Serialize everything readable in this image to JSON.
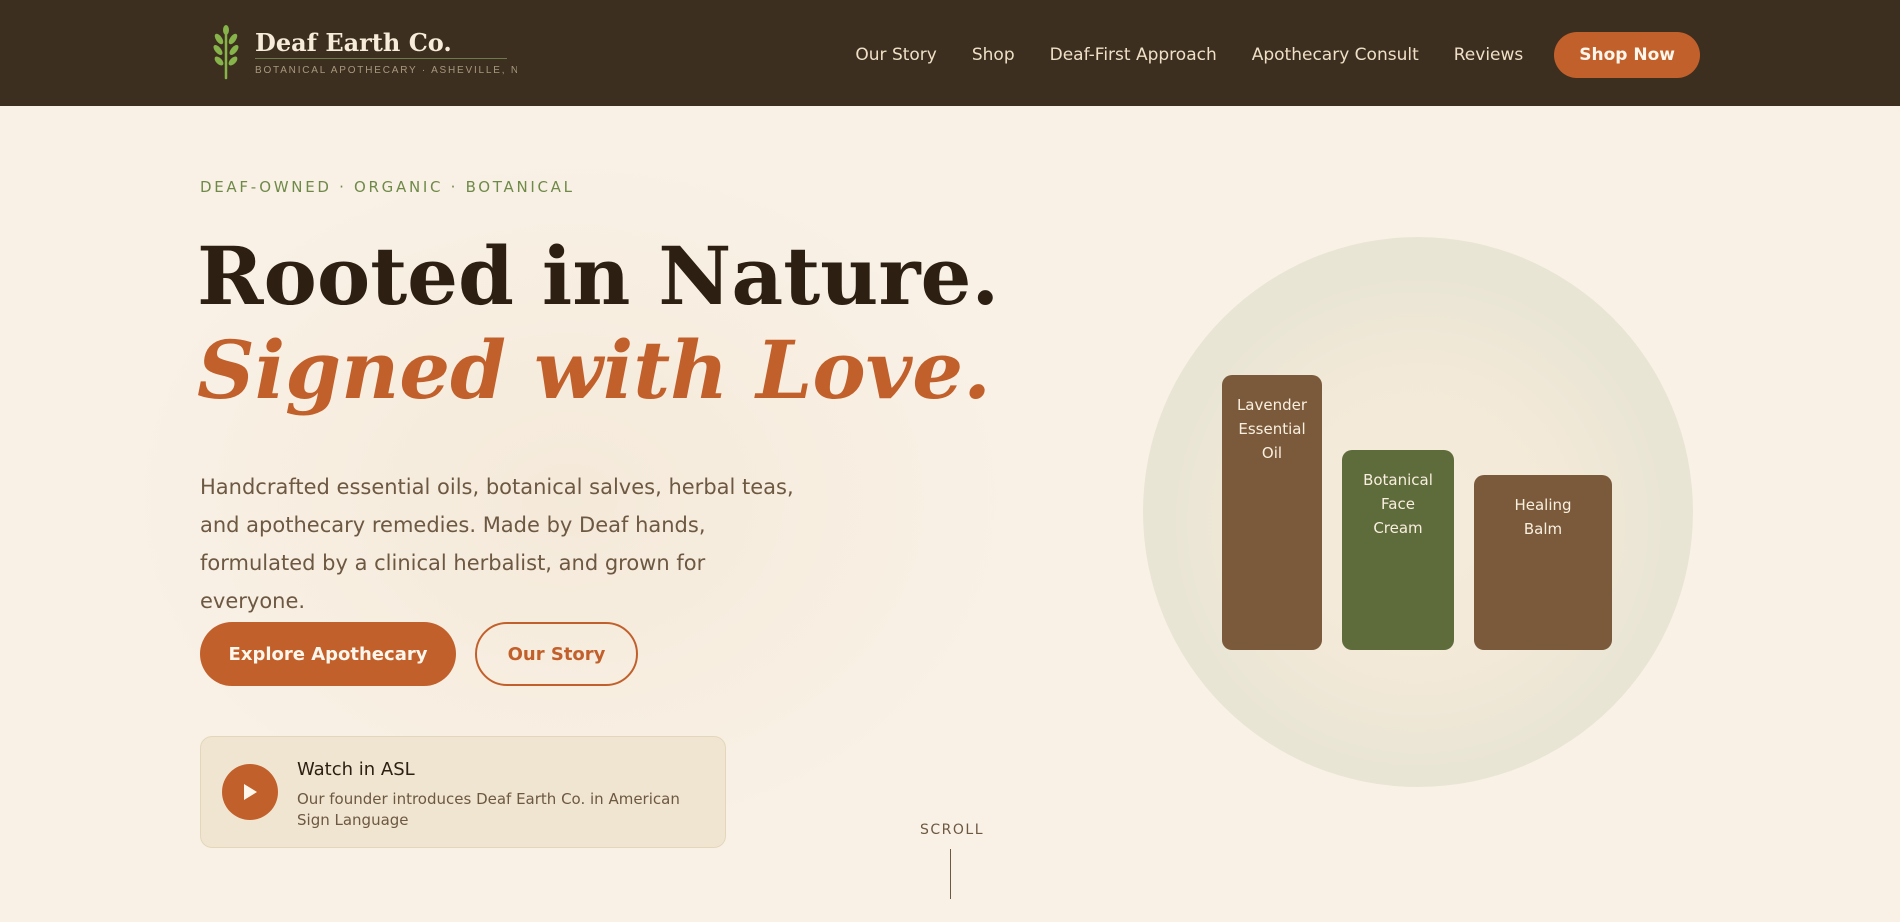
{
  "header": {
    "brand_name": "Deaf Earth Co.",
    "brand_tagline": "BOTANICAL APOTHECARY · ASHEVILLE, NC",
    "nav": [
      {
        "label": "Our Story"
      },
      {
        "label": "Shop"
      },
      {
        "label": "Deaf-First Approach"
      },
      {
        "label": "Apothecary Consult"
      },
      {
        "label": "Reviews"
      }
    ],
    "cta_label": "Shop Now"
  },
  "hero": {
    "eyebrow": "DEAF-OWNED · ORGANIC · BOTANICAL",
    "headline_line1": "Rooted in Nature.",
    "headline_line2": "Signed with Love.",
    "lede": "Handcrafted essential oils, botanical salves, herbal teas, and apothecary remedies. Made by Deaf hands, formulated by a clinical herbalist, and grown for everyone.",
    "primary_button": "Explore Apothecary",
    "secondary_button": "Our Story",
    "asl_card": {
      "icon": "play-icon",
      "title": "Watch in ASL",
      "description": "Our founder introduces Deaf Earth Co. in American Sign Language"
    },
    "scroll_label": "SCROLL"
  },
  "products": [
    {
      "lines": [
        "Lavender",
        "Essential",
        "Oil"
      ]
    },
    {
      "lines": [
        "Botanical",
        "Face",
        "Cream"
      ]
    },
    {
      "lines": [
        "Healing",
        "Balm"
      ]
    }
  ],
  "colors": {
    "header_bg": "#3d2f1f",
    "page_bg": "#f9f1e6",
    "accent": "#c2602c",
    "green": "#6f8a48",
    "dark_text": "#2d2013"
  }
}
